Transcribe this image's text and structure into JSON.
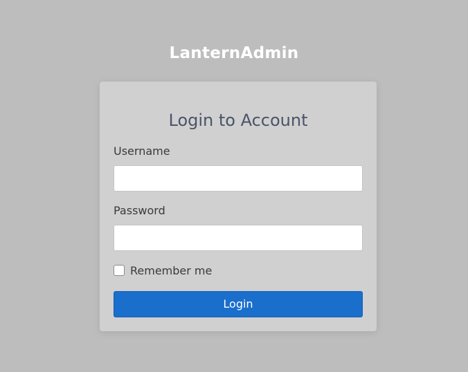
{
  "brand": {
    "name": "LanternAdmin"
  },
  "login_form": {
    "title": "Login to Account",
    "username_label": "Username",
    "username_value": "",
    "password_label": "Password",
    "password_value": "",
    "remember_label": "Remember me",
    "remember_checked": false,
    "submit_label": "Login"
  },
  "colors": {
    "background": "#bdbdbd",
    "card": "#d0d0d0",
    "primary_button": "#1a6ecc",
    "title_text": "#4a5368"
  }
}
